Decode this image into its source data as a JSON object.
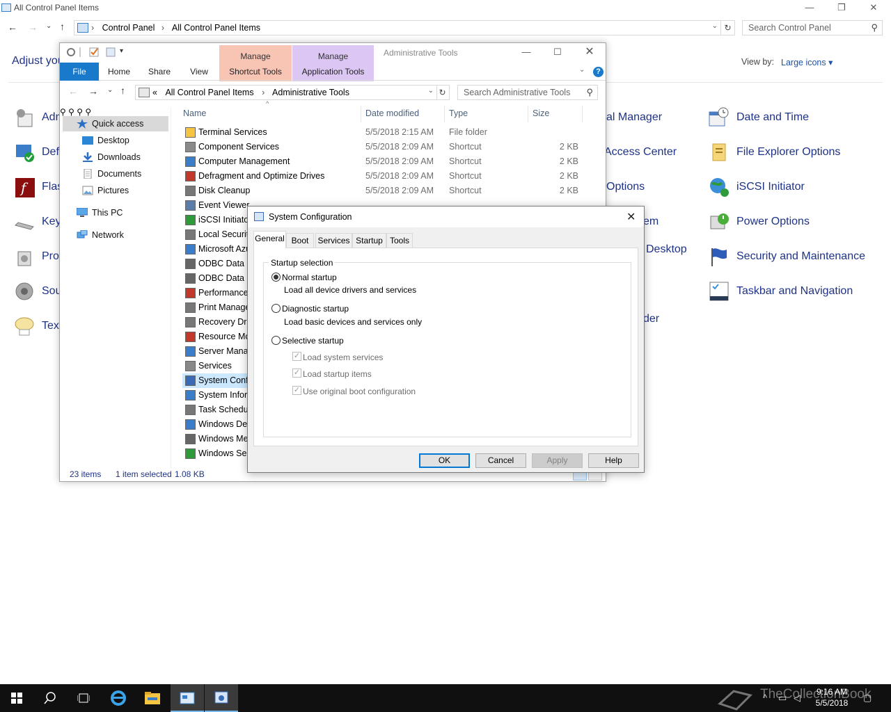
{
  "control_panel": {
    "window_title": "All Control Panel Items",
    "address": [
      "Control Panel",
      "All Control Panel Items"
    ],
    "search_placeholder": "Search Control Panel",
    "heading": "Adjust you",
    "view_by_label": "View by:",
    "view_by_value": "Large icons ▾",
    "left_items": [
      "Adm",
      "Def",
      "Flas",
      "Key",
      "Pro",
      "Sou",
      "Text"
    ],
    "middle_items": [
      "al Manager",
      "Access Center",
      "Options",
      "em",
      "Desktop",
      "der"
    ],
    "right_items": [
      "Date and Time",
      "File Explorer Options",
      "iSCSI Initiator",
      "Power Options",
      "Security and Maintenance",
      "Taskbar and Navigation"
    ]
  },
  "explorer": {
    "title": "Administrative Tools",
    "context_tabs": [
      "Manage",
      "Manage"
    ],
    "ribbon_tabs": [
      "File",
      "Home",
      "Share",
      "View",
      "Shortcut Tools",
      "Application Tools"
    ],
    "address_prefix": "«",
    "address": [
      "All Control Panel Items",
      "Administrative Tools"
    ],
    "search_placeholder": "Search Administrative Tools",
    "nav": {
      "quick_access": "Quick access",
      "desktop": "Desktop",
      "downloads": "Downloads",
      "documents": "Documents",
      "pictures": "Pictures",
      "this_pc": "This PC",
      "network": "Network"
    },
    "columns": [
      "Name",
      "Date modified",
      "Type",
      "Size"
    ],
    "files": [
      {
        "name": "Terminal Services",
        "date": "5/5/2018 2:15 AM",
        "type": "File folder",
        "size": ""
      },
      {
        "name": "Component Services",
        "date": "5/5/2018 2:09 AM",
        "type": "Shortcut",
        "size": "2 KB"
      },
      {
        "name": "Computer Management",
        "date": "5/5/2018 2:09 AM",
        "type": "Shortcut",
        "size": "2 KB"
      },
      {
        "name": "Defragment and Optimize Drives",
        "date": "5/5/2018 2:09 AM",
        "type": "Shortcut",
        "size": "2 KB"
      },
      {
        "name": "Disk Cleanup",
        "date": "5/5/2018 2:09 AM",
        "type": "Shortcut",
        "size": "2 KB"
      },
      {
        "name": "Event Viewer",
        "date": "",
        "type": "",
        "size": ""
      },
      {
        "name": "iSCSI Initiator",
        "date": "",
        "type": "",
        "size": ""
      },
      {
        "name": "Local Security",
        "date": "",
        "type": "",
        "size": ""
      },
      {
        "name": "Microsoft Azu",
        "date": "",
        "type": "",
        "size": ""
      },
      {
        "name": "ODBC Data So",
        "date": "",
        "type": "",
        "size": ""
      },
      {
        "name": "ODBC Data So",
        "date": "",
        "type": "",
        "size": ""
      },
      {
        "name": "Performance",
        "date": "",
        "type": "",
        "size": ""
      },
      {
        "name": "Print Manage",
        "date": "",
        "type": "",
        "size": ""
      },
      {
        "name": "Recovery Driv",
        "date": "",
        "type": "",
        "size": ""
      },
      {
        "name": "Resource Mon",
        "date": "",
        "type": "",
        "size": ""
      },
      {
        "name": "Server Manag",
        "date": "",
        "type": "",
        "size": ""
      },
      {
        "name": "Services",
        "date": "",
        "type": "",
        "size": ""
      },
      {
        "name": "System Confi",
        "date": "",
        "type": "",
        "size": ""
      },
      {
        "name": "System Inforn",
        "date": "",
        "type": "",
        "size": ""
      },
      {
        "name": "Task Schedule",
        "date": "",
        "type": "",
        "size": ""
      },
      {
        "name": "Windows Def",
        "date": "",
        "type": "",
        "size": ""
      },
      {
        "name": "Windows Mer",
        "date": "",
        "type": "",
        "size": ""
      },
      {
        "name": "Windows Serv",
        "date": "",
        "type": "",
        "size": ""
      }
    ],
    "status": {
      "count": "23 items",
      "selected": "1 item selected",
      "size": "1.08 KB"
    }
  },
  "dialog": {
    "title": "System Configuration",
    "tabs": [
      "General",
      "Boot",
      "Services",
      "Startup",
      "Tools"
    ],
    "group_label": "Startup selection",
    "normal": {
      "label": "Normal startup",
      "desc": "Load all device drivers and services",
      "selected": true
    },
    "diagnostic": {
      "label": "Diagnostic startup",
      "desc": "Load basic devices and services only",
      "selected": false
    },
    "selective": {
      "label": "Selective startup",
      "selected": false
    },
    "checks": [
      {
        "label": "Load system services",
        "checked": true
      },
      {
        "label": "Load startup items",
        "checked": true
      },
      {
        "label": "Use original boot configuration",
        "checked": true
      }
    ],
    "buttons": {
      "ok": "OK",
      "cancel": "Cancel",
      "apply": "Apply",
      "help": "Help"
    }
  },
  "taskbar": {
    "time": "9:16 AM",
    "date": "5/5/2018",
    "watermark": "TheCollectionBook"
  },
  "colors": {
    "link": "#1e3287",
    "accent": "#1979ca",
    "selected_row": "#cce8ff"
  }
}
